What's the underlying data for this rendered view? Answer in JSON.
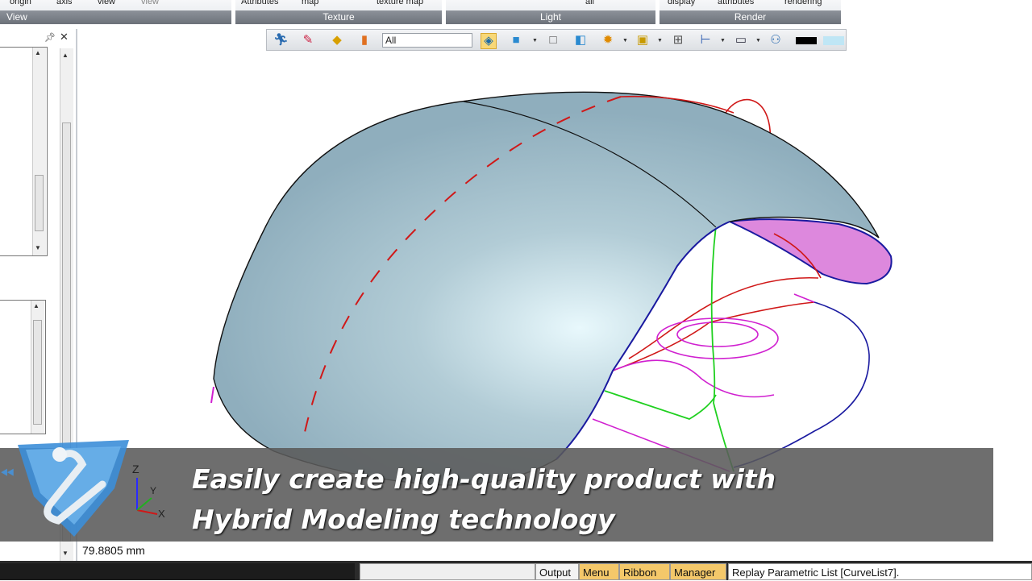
{
  "ribbon": {
    "groups": [
      {
        "title": "View",
        "labels": [
          "origin",
          "axis",
          "view",
          "view"
        ]
      },
      {
        "title": "Texture",
        "labels": [
          "Attributes",
          "map",
          "texture map"
        ]
      },
      {
        "title": "Light",
        "labels": [
          "all"
        ]
      },
      {
        "title": "Render",
        "labels": [
          "display",
          "attributes",
          "rendering"
        ]
      }
    ]
  },
  "toolbar": {
    "filter_value": "All",
    "icons": [
      "run-icon",
      "eraser-icon",
      "box-tool-icon",
      "bar-filter-icon",
      "select-solid-icon",
      "solid-cube-icon",
      "wire-cube-icon",
      "shaded-cube-icon",
      "sphere-snap-icon",
      "surface-icon",
      "grid-icon",
      "dimension-icon",
      "monitor-icon",
      "connect-icon",
      "black-color-icon",
      "light-color-icon"
    ],
    "colors": {
      "black": "#000000",
      "light": "#bfe6f5"
    }
  },
  "caption": {
    "line1": "Easily create high-quality product with",
    "line2": "Hybrid Modeling technology"
  },
  "axes": {
    "z": "Z",
    "y": "Y",
    "x": "X"
  },
  "measure": {
    "value": "79.8805 mm"
  },
  "statusbar": {
    "tabs": [
      "Output",
      "Menu",
      "Ribbon",
      "Manager"
    ],
    "message": "Replay Parametric List [CurveList7]."
  }
}
